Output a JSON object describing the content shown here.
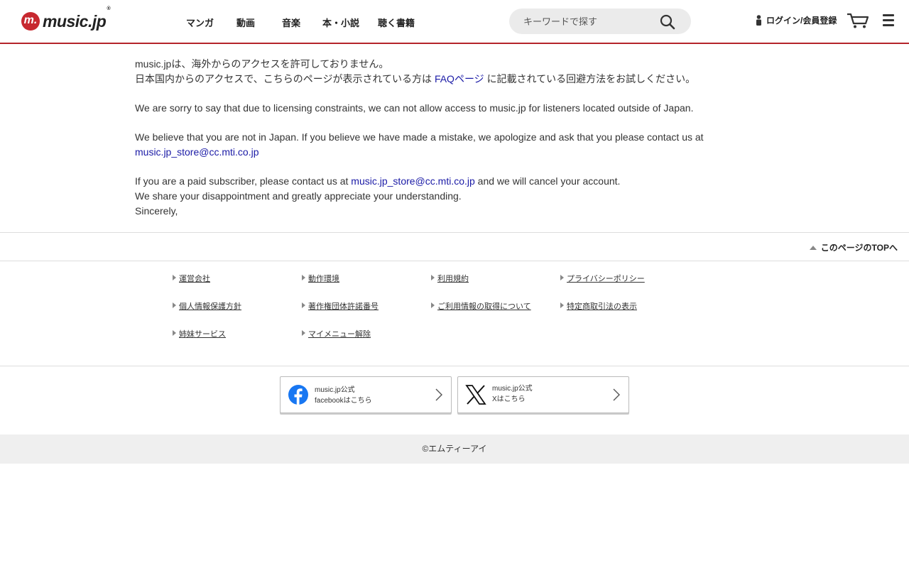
{
  "header": {
    "logo_mark": "m.",
    "logo_text": "music.jp",
    "logo_reg": "®",
    "nav": [
      {
        "label": "マンガ"
      },
      {
        "label": "動画"
      },
      {
        "label": "音楽"
      },
      {
        "label": "本・小説"
      },
      {
        "label": "聴く書籍"
      }
    ],
    "search_placeholder": "キーワードで探す",
    "login_label": "ログイン/会員登録"
  },
  "main": {
    "line1": "music.jpは、海外からのアクセスを許可しておりません。",
    "line2_before": "日本国内からのアクセスで、こちらのページが表示されている方は",
    "faq_link": "FAQページ",
    "line2_after": "に記載されている回避方法をお試しください。",
    "en_p1": "We are sorry to say that due to licensing constraints, we can not allow access to music.jp for listeners located outside of Japan.",
    "en_p2": "We believe that you are not in Japan. If you believe we have made a mistake, we apologize and ask that you please contact us at",
    "email": "music.jp_store@cc.mti.co.jp",
    "en_p3_before": "If you are a paid subscriber, please contact us at",
    "en_p3_after": "and we will cancel your account.",
    "en_p4": "We share your disappointment and greatly appreciate your understanding.",
    "en_p5": "Sincerely,"
  },
  "pagetop": "このページのTOPへ",
  "footer_links": [
    [
      "運営会社",
      "動作環境",
      "利用規約",
      "プライバシーポリシー"
    ],
    [
      "個人情報保護方針",
      "著作権団体許諾番号",
      "ご利用情報の取得について",
      "特定商取引法の表示"
    ],
    [
      "姉妹サービス",
      "マイメニュー解除"
    ]
  ],
  "social": {
    "facebook_line1": "music.jp公式",
    "facebook_line2": "facebookはこちら",
    "x_line1": "music.jp公式",
    "x_line2": "Xはこちら"
  },
  "copyright": "©エムティーアイ",
  "colors": {
    "brand_red": "#c7282f",
    "header_border": "#b5252b",
    "link": "#1a1aa6",
    "facebook": "#1877f2"
  }
}
